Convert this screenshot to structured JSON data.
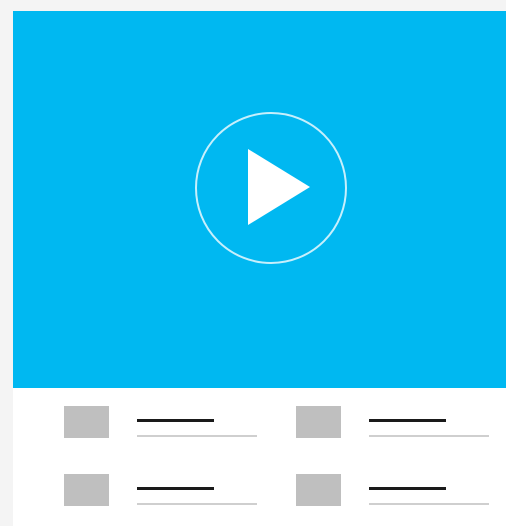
{
  "colors": {
    "video_background": "#00b8f1",
    "thumbnail": "#bfbfbf",
    "title_line": "#1a1a1a",
    "subtitle_line": "#cfcfcf",
    "card_background": "#ffffff",
    "page_background": "#f4f4f4"
  },
  "video": {
    "play_icon": "play-icon"
  },
  "items": [
    {
      "thumbnail_icon": "thumbnail-placeholder",
      "title_placeholder": "text-line",
      "subtitle_placeholder": "text-line"
    },
    {
      "thumbnail_icon": "thumbnail-placeholder",
      "title_placeholder": "text-line",
      "subtitle_placeholder": "text-line"
    },
    {
      "thumbnail_icon": "thumbnail-placeholder",
      "title_placeholder": "text-line",
      "subtitle_placeholder": "text-line"
    },
    {
      "thumbnail_icon": "thumbnail-placeholder",
      "title_placeholder": "text-line",
      "subtitle_placeholder": "text-line"
    }
  ]
}
